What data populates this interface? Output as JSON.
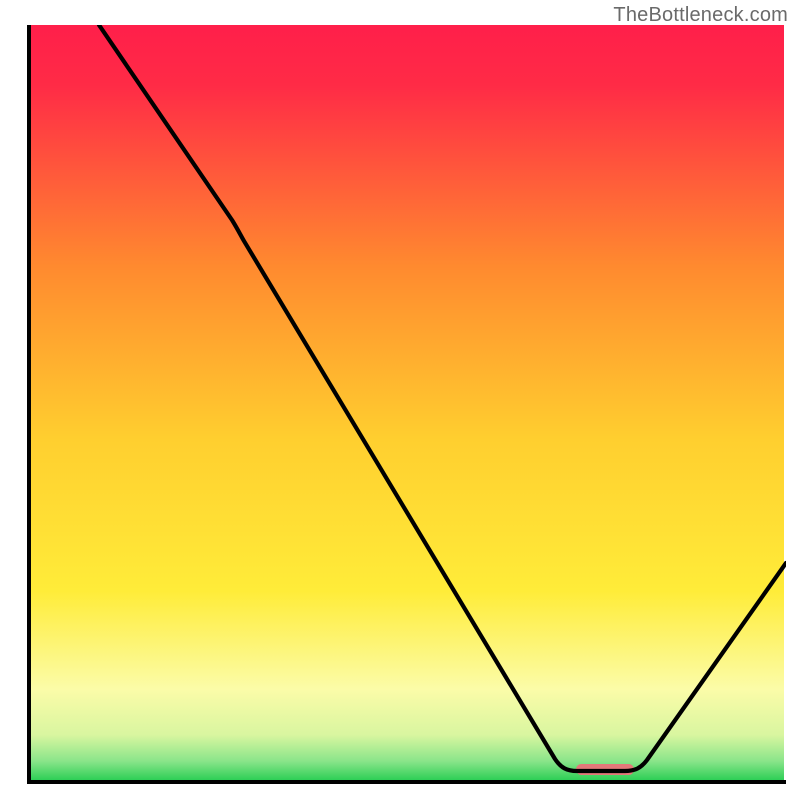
{
  "watermark": "TheBottleneck.com",
  "chart_data": {
    "type": "line",
    "title": "",
    "xlabel": "",
    "ylabel": "",
    "xlim": [
      0,
      100
    ],
    "ylim": [
      0,
      100
    ],
    "series": [
      {
        "name": "curve",
        "points": [
          {
            "x": 9.5,
            "y": 100
          },
          {
            "x": 27,
            "y": 74
          },
          {
            "x": 70,
            "y": 2.5
          },
          {
            "x": 73,
            "y": 1.2
          },
          {
            "x": 79,
            "y": 1.2
          },
          {
            "x": 82,
            "y": 2.5
          },
          {
            "x": 100,
            "y": 29
          }
        ]
      }
    ],
    "marker": {
      "x_start": 73,
      "x_end": 80,
      "y": 1.5,
      "color": "#e3787a"
    },
    "background_gradient": {
      "top": "#ff1f4a",
      "mid_upper": "#ff9b2f",
      "mid": "#ffe233",
      "lower": "#fbfca8",
      "bottom": "#2ecf56"
    },
    "axes_color": "#000000"
  }
}
